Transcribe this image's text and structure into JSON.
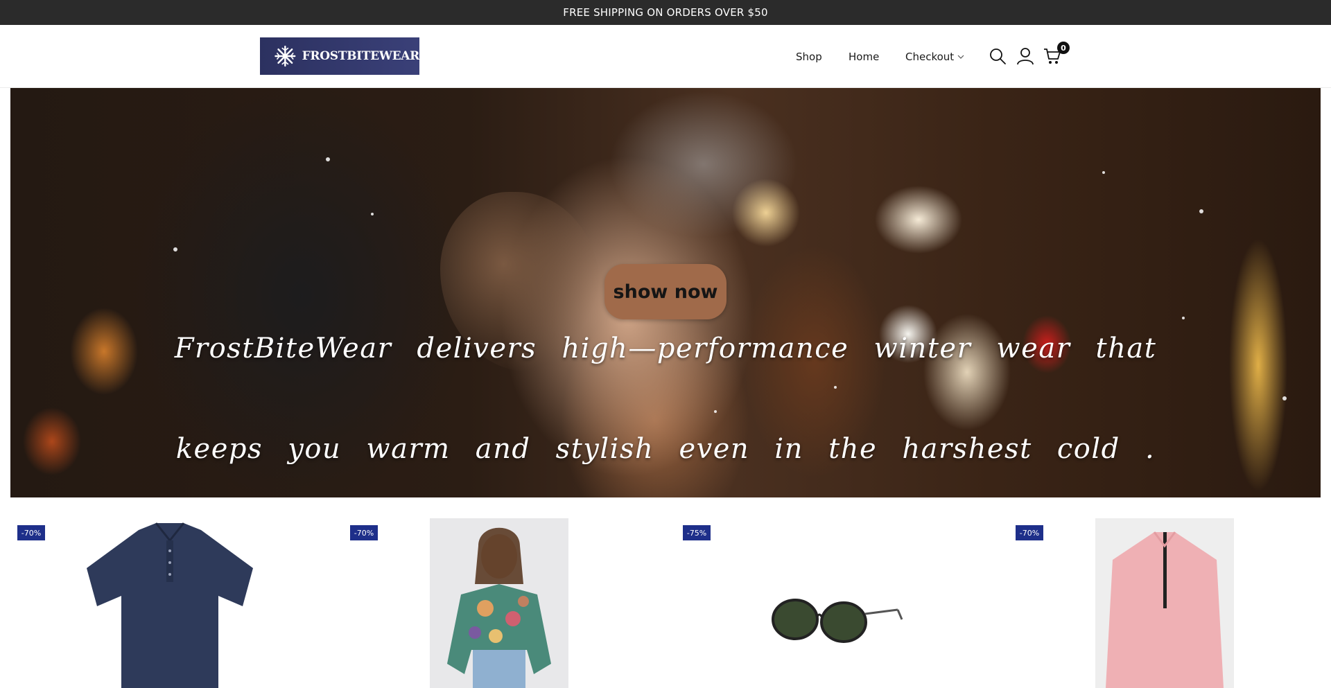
{
  "announcement": {
    "text": "FREE SHIPPING ON ORDERS OVER $50"
  },
  "header": {
    "logo_text": "FROSTBITEWEAR",
    "nav": {
      "shop": "Shop",
      "home": "Home",
      "checkout": "Checkout"
    },
    "cart_count": "0",
    "icons": [
      "search-icon",
      "user-icon",
      "cart-icon",
      "chevron-down-icon"
    ]
  },
  "hero": {
    "button_label": "show now",
    "tagline_line1": "FrostBiteWear delivers high—performance winter wear that",
    "tagline_line2": "keeps you warm and stylish even in the harshest cold .",
    "button_color": "#a06a4a"
  },
  "products": [
    {
      "discount": "-70%",
      "image": "navy-polo-shirt"
    },
    {
      "discount": "-70%",
      "image": "floral-blouse"
    },
    {
      "discount": "-75%",
      "image": "sunglasses"
    },
    {
      "discount": "-70%",
      "image": "pink-quarter-zip-top"
    }
  ],
  "colors": {
    "announcement_bg": "#2b2b2b",
    "badge_bg": "#1e2f8a",
    "logo_bg": "#2c3160"
  }
}
